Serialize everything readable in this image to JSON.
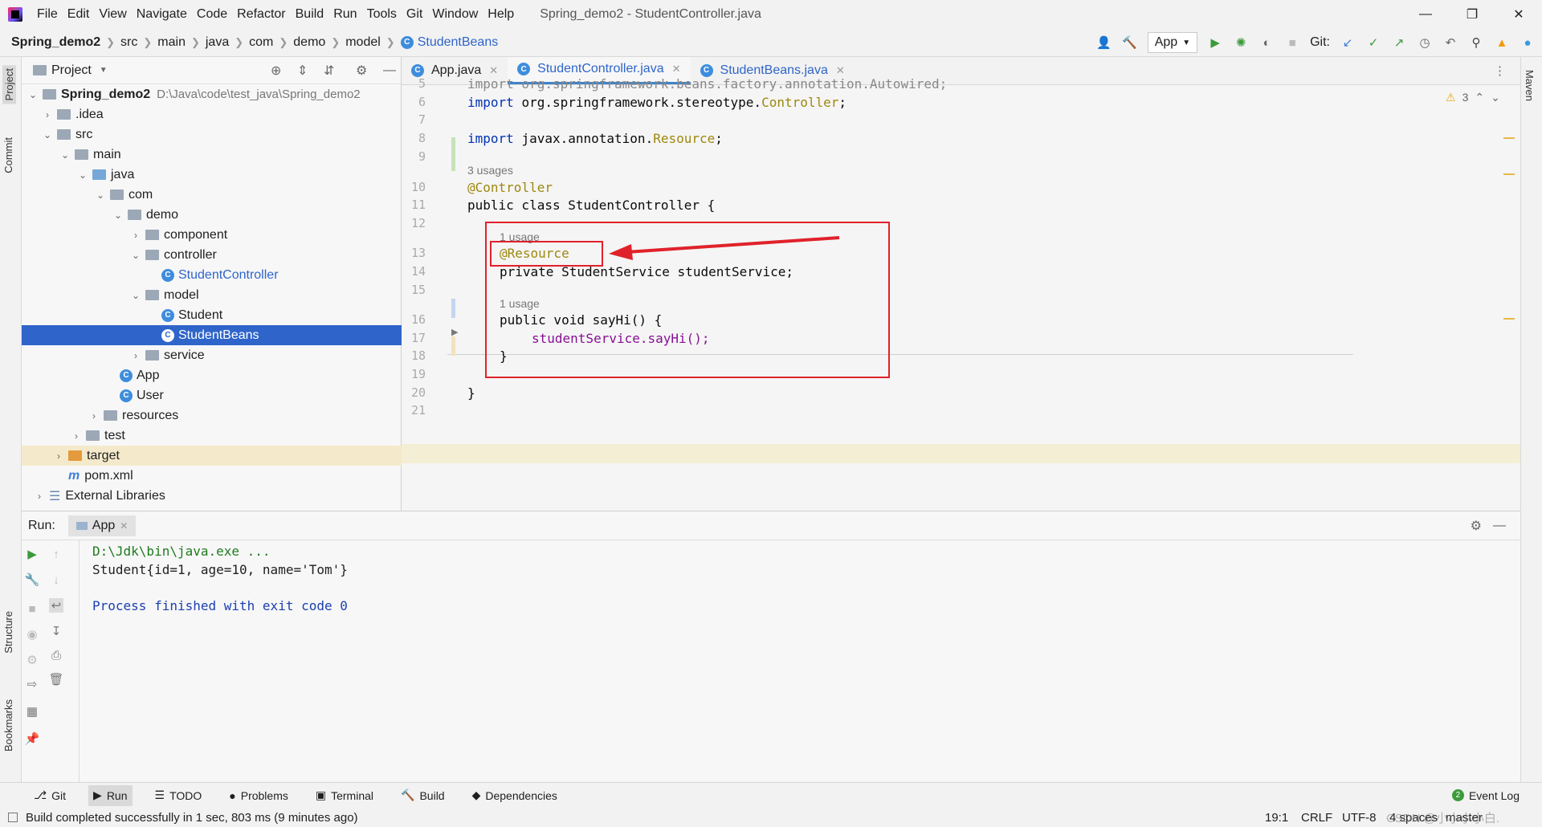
{
  "menu": [
    "File",
    "Edit",
    "View",
    "Navigate",
    "Code",
    "Refactor",
    "Build",
    "Run",
    "Tools",
    "Git",
    "Window",
    "Help"
  ],
  "window_title": "Spring_demo2 - StudentController.java",
  "breadcrumb": [
    "Spring_demo2",
    "src",
    "main",
    "java",
    "com",
    "demo",
    "model",
    "StudentBeans"
  ],
  "toolbar": {
    "run_config": "App",
    "git_label": "Git:"
  },
  "project_panel": {
    "title": "Project",
    "tree": [
      {
        "label": "Spring_demo2",
        "path": "D:\\Java\\code\\test_java\\Spring_demo2"
      },
      {
        "label": ".idea"
      },
      {
        "label": "src"
      },
      {
        "label": "main"
      },
      {
        "label": "java"
      },
      {
        "label": "com"
      },
      {
        "label": "demo"
      },
      {
        "label": "component"
      },
      {
        "label": "controller"
      },
      {
        "label": "StudentController"
      },
      {
        "label": "model"
      },
      {
        "label": "Student"
      },
      {
        "label": "StudentBeans"
      },
      {
        "label": "service"
      },
      {
        "label": "App"
      },
      {
        "label": "User"
      },
      {
        "label": "resources"
      },
      {
        "label": "test"
      },
      {
        "label": "target"
      },
      {
        "label": "pom.xml"
      },
      {
        "label": "External Libraries"
      }
    ]
  },
  "tabs": [
    "App.java",
    "StudentController.java",
    "StudentBeans.java"
  ],
  "editor": {
    "warnings": "3",
    "lines": [
      {
        "n": "5",
        "text": "import org.springframework.beans.factory.annotation.Autowired;"
      },
      {
        "n": "6",
        "a": "import ",
        "b": "org.springframework.stereotype.",
        "c": "Controller",
        ";": ";"
      },
      {
        "n": "7"
      },
      {
        "n": "8",
        "a": "import ",
        "b": "javax.annotation.",
        "c": "Resource"
      },
      {
        "n": "9"
      },
      {
        "n": "10",
        "text": "@Controller"
      },
      {
        "n": "11",
        "text": "public class StudentController {"
      },
      {
        "n": "12"
      },
      {
        "n": "13",
        "text": "@Resource"
      },
      {
        "n": "14",
        "text": "private StudentService studentService;"
      },
      {
        "n": "15"
      },
      {
        "n": "16",
        "text": "public void sayHi() {"
      },
      {
        "n": "17",
        "text": "studentService.sayHi();"
      },
      {
        "n": "18",
        "text": "}"
      },
      {
        "n": "19"
      },
      {
        "n": "20",
        "text": "}"
      },
      {
        "n": "21"
      }
    ],
    "hints": {
      "three": "3 usages",
      "one_a": "1 usage",
      "one_b": "1 usage"
    }
  },
  "run": {
    "label": "Run:",
    "tab": "App",
    "output": [
      "D:\\Jdk\\bin\\java.exe ...",
      "Student{id=1, age=10, name='Tom'}",
      "",
      "Process finished with exit code 0"
    ]
  },
  "bottom_tabs": [
    "Git",
    "Run",
    "TODO",
    "Problems",
    "Terminal",
    "Build",
    "Dependencies"
  ],
  "event_log": "Event Log",
  "event_count": "2",
  "status": {
    "message": "Build completed successfully in 1 sec, 803 ms (9 minutes ago)",
    "pos": "19:1",
    "eol": "CRLF",
    "enc": "UTF-8",
    "indent": "4 spaces",
    "branch": "master"
  },
  "side_labels": {
    "project": "Project",
    "commit": "Commit",
    "structure": "Structure",
    "bookmarks": "Bookmarks",
    "maven": "Maven"
  },
  "watermark": "CSDN @小小小小白.",
  "colors": {
    "accent": "#2f65ca",
    "annotation_box": "#e0222a"
  }
}
